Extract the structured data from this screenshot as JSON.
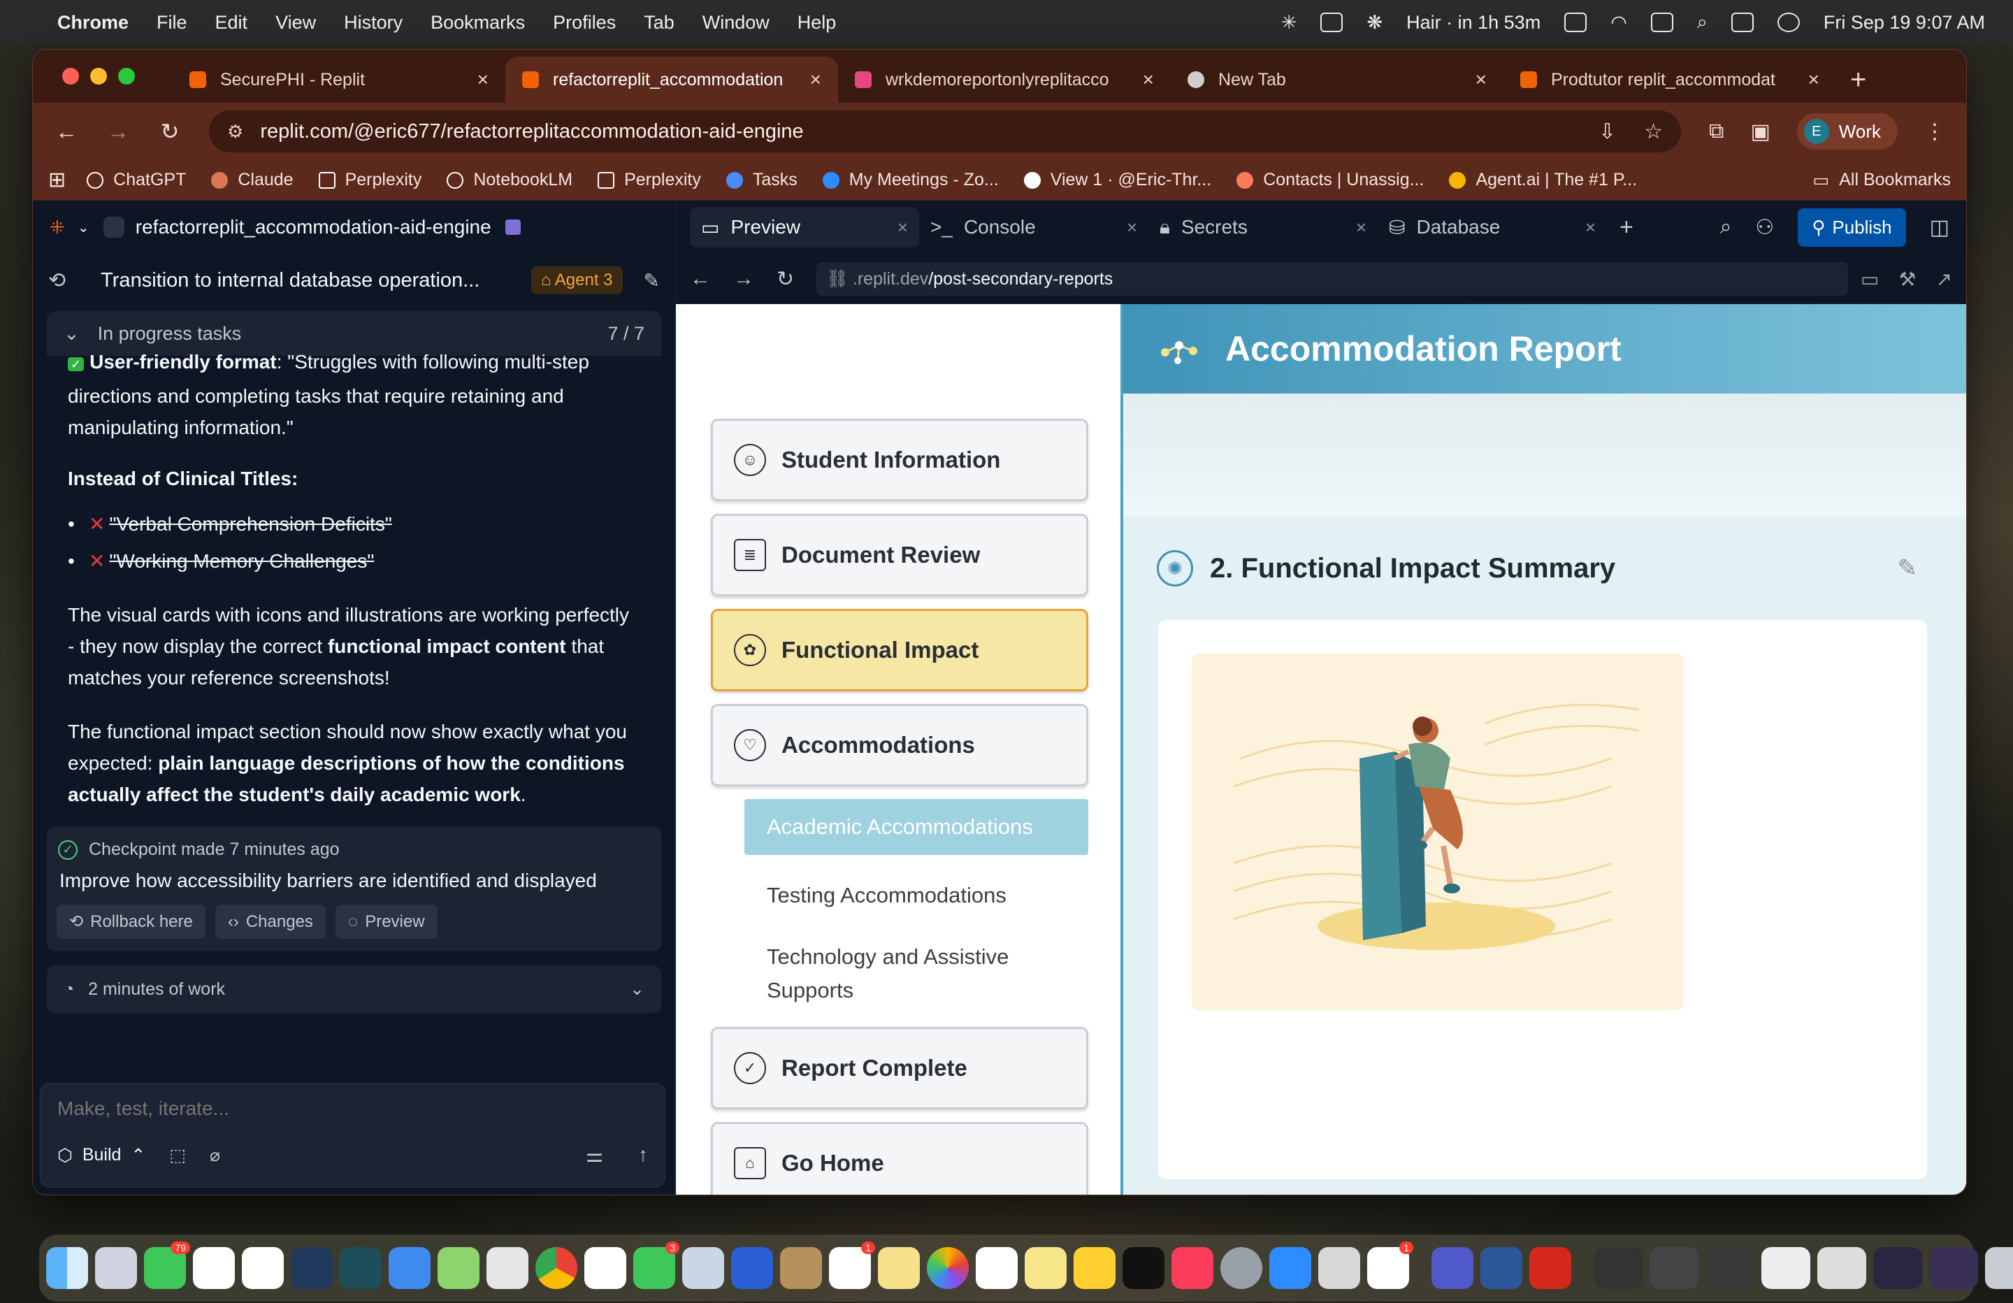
{
  "menubar": {
    "app_name": "Chrome",
    "menus": [
      "File",
      "Edit",
      "View",
      "History",
      "Bookmarks",
      "Profiles",
      "Tab",
      "Window",
      "Help"
    ],
    "status_event": "Hair · in 1h 53m",
    "datetime": "Fri Sep 19  9:07 AM"
  },
  "tabs": [
    {
      "title": "SecurePHI - Replit",
      "favicon_color": "#f26207",
      "active": false
    },
    {
      "title": "refactorreplit_accommodation",
      "favicon_color": "#f26207",
      "active": true
    },
    {
      "title": "wrkdemoreportonlyreplitacco",
      "favicon_color": "#e8477a",
      "active": false
    },
    {
      "title": "New Tab",
      "favicon_color": "#cfcfcf",
      "active": false
    },
    {
      "title": "Prodtutor replit_accommodat",
      "favicon_color": "#f26207",
      "active": false
    }
  ],
  "address_bar": {
    "url": "replit.com/@eric677/refactorreplitaccommodation-aid-engine"
  },
  "profile": {
    "initial": "E",
    "label": "Work"
  },
  "bookmarks": [
    {
      "label": "ChatGPT",
      "color": "#ffffff"
    },
    {
      "label": "Claude",
      "color": "#d97757"
    },
    {
      "label": "Perplexity",
      "color": "#ffffff"
    },
    {
      "label": "NotebookLM",
      "color": "#ffffff"
    },
    {
      "label": "Perplexity",
      "color": "#ffffff"
    },
    {
      "label": "Tasks",
      "color": "#4a8cf7"
    },
    {
      "label": "My Meetings - Zo...",
      "color": "#2d8cff"
    },
    {
      "label": "View 1 · @Eric-Thr...",
      "color": "#ffffff"
    },
    {
      "label": "Contacts | Unassig...",
      "color": "#ff7a59"
    },
    {
      "label": "Agent.ai | The #1 P...",
      "color": "#f7b500"
    }
  ],
  "all_bookmarks_label": "All Bookmarks",
  "replit": {
    "project_name": "refactorreplit_accommodation-aid-engine",
    "thread_title": "Transition to internal database operation...",
    "agent_badge": "Agent 3",
    "tasks_label": "In progress tasks",
    "tasks_count": "7 / 7",
    "chat": {
      "line1_bold": "User-friendly format",
      "line1_rest": ": \"Struggles with following multi-step directions and completing tasks that require retaining and manipulating information.\"",
      "heading": "Instead of Clinical Titles:",
      "bullets": [
        "\"Verbal Comprehension Deficits\"",
        "\"Working Memory Challenges\""
      ],
      "para1_a": "The visual cards with icons and illustrations are working perfectly - they now display the correct ",
      "para1_bold": "functional impact content",
      "para1_b": " that matches your reference screenshots!",
      "para2_a": "The functional impact section should now show exactly what you expected: ",
      "para2_bold": "plain language descriptions of how the conditions actually affect the student's daily academic work",
      "para2_b": "."
    },
    "checkpoint": {
      "label": "Checkpoint made 7 minutes ago",
      "description": "Improve how accessibility barriers are identified and displayed",
      "buttons": [
        "Rollback here",
        "Changes",
        "Preview"
      ]
    },
    "work_time": "2 minutes of work",
    "composer_placeholder": "Make, test, iterate...",
    "build_label": "Build",
    "pane_tabs": [
      "Preview",
      "Console",
      "Secrets",
      "Database"
    ],
    "publish_label": "Publish",
    "preview_url_dim": ".replit.dev",
    "preview_url_path": "/post-secondary-reports"
  },
  "app": {
    "report_title": "Accommodation Report",
    "nav_items": [
      {
        "label": "Student Information",
        "active": false
      },
      {
        "label": "Document Review",
        "active": false
      },
      {
        "label": "Functional Impact",
        "active": true
      },
      {
        "label": "Accommodations",
        "active": false
      }
    ],
    "sub_items": [
      {
        "label": "Academic Accommodations",
        "active": true
      },
      {
        "label": "Testing Accommodations",
        "active": false
      },
      {
        "label": "Technology and Assistive Supports",
        "active": false
      }
    ],
    "bottom_nav": [
      {
        "label": "Report Complete"
      },
      {
        "label": "Go Home"
      }
    ],
    "section_title": "2. Functional Impact Summary"
  },
  "colors": {
    "accent_orange": "#f26207",
    "nav_active_bg": "#f7e7a5",
    "sub_active_bg": "#9fd2df",
    "header_blue": "#3f93b8",
    "publish_blue": "#0053a6"
  }
}
